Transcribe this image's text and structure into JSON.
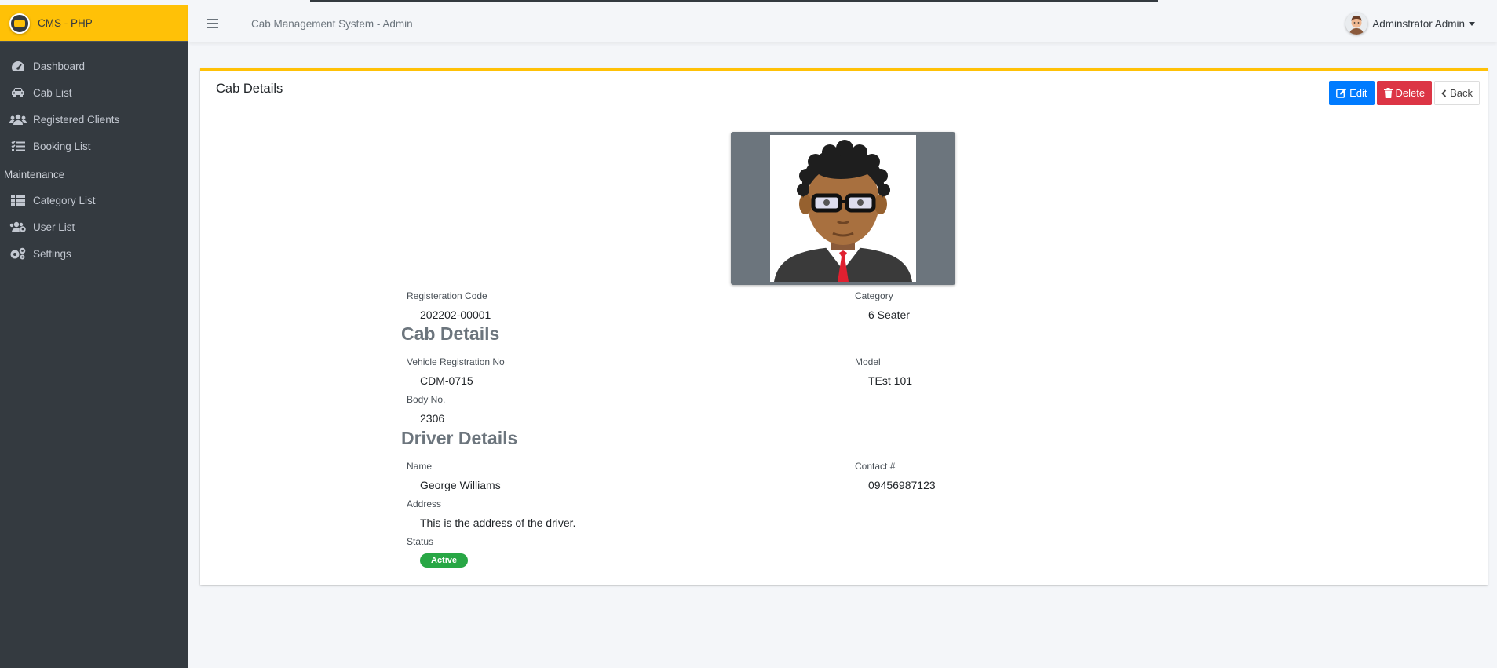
{
  "brand": {
    "name": "CMS - PHP"
  },
  "header": {
    "title": "Cab Management System - Admin",
    "user_name": "Adminstrator Admin"
  },
  "sidebar": {
    "items": [
      {
        "label": "Dashboard",
        "icon": "tachometer-icon"
      },
      {
        "label": "Cab List",
        "icon": "car-icon"
      },
      {
        "label": "Registered Clients",
        "icon": "users-icon"
      },
      {
        "label": "Booking List",
        "icon": "tasks-icon"
      }
    ],
    "maintenance_header": "Maintenance",
    "maintenance_items": [
      {
        "label": "Category List",
        "icon": "th-list-icon"
      },
      {
        "label": "User List",
        "icon": "users-cog-icon"
      },
      {
        "label": "Settings",
        "icon": "cogs-icon"
      }
    ]
  },
  "card": {
    "title": "Cab Details",
    "buttons": {
      "edit": "Edit",
      "delete": "Delete",
      "back": "Back"
    }
  },
  "details": {
    "registration_code_label": "Registeration Code",
    "registration_code": "202202-00001",
    "category_label": "Category",
    "category": "6 Seater",
    "cab_section": "Cab Details",
    "vehicle_reg_label": "Vehicle Registration No",
    "vehicle_reg": "CDM-0715",
    "model_label": "Model",
    "model": "TEst 101",
    "body_no_label": "Body No.",
    "body_no": "2306",
    "driver_section": "Driver Details",
    "name_label": "Name",
    "name": "George Williams",
    "contact_label": "Contact #",
    "contact": "09456987123",
    "address_label": "Address",
    "address": "This is the address of the driver.",
    "status_label": "Status",
    "status": "Active"
  },
  "colors": {
    "accent": "#ffc107",
    "sidebar": "#343a40",
    "edit": "#007bff",
    "delete": "#dc3545",
    "active": "#28a745"
  }
}
